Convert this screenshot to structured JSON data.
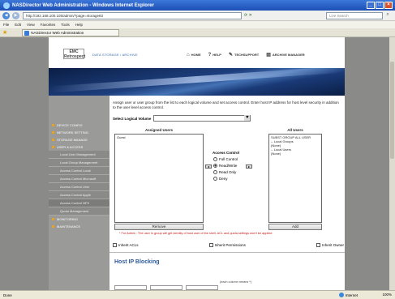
{
  "window": {
    "title": "NASDirector Web Administration - Windows Internet Explorer",
    "controls": [
      "_",
      "□",
      "×"
    ]
  },
  "address_bar": {
    "url": "http://192.168.100.105/admin/?page=storage83",
    "search_placeholder": "Live Search"
  },
  "menu": [
    "File",
    "Edit",
    "View",
    "Favorites",
    "Tools",
    "Help"
  ],
  "tab": {
    "label": "NASDirector Web Administration"
  },
  "header": {
    "logo_line1": "EMC",
    "logo_line2": "Retrospect",
    "tagline": "DATA STORAGE / ARCHIVE",
    "nav": [
      {
        "icon": "home-icon",
        "glyph": "⌂",
        "label": "HOME"
      },
      {
        "icon": "help-icon",
        "glyph": "?",
        "label": "HELP"
      },
      {
        "icon": "wrench-icon",
        "glyph": "✎",
        "label": "TECHSUPPORT"
      },
      {
        "icon": "archive-icon",
        "glyph": "▤",
        "label": "ARCHIVE MANAGER"
      }
    ]
  },
  "sidebar": {
    "items": [
      "DEVICE CONFIG",
      "NETWORK SETTING",
      "STORAGE MANAGE",
      "USER & ACCESS"
    ],
    "subitems": [
      "Local User Management",
      "Local Group Management",
      "Access Control Local",
      "Access Control Microsoft",
      "Access Control Unix",
      "Access Control Apple",
      "Access Control NFS",
      "Quota Management"
    ],
    "bottom_items": [
      "MONITORING",
      "MAINTENANCE"
    ]
  },
  "content": {
    "instructions": "Assign user or user group from the list to each logical volume and set access control. Enter host IP address for host level security in addition to the user level access control.",
    "volume_label": "Select Logical Volume",
    "assigned_title": "Assigned Users",
    "assigned_users": [
      "Guest"
    ],
    "all_users_title": "All Users",
    "all_users": [
      "SUBST GROUP ALL USER",
      "-- Local Groups",
      "(None)",
      "-- Local Users",
      "(None)"
    ],
    "access_control_title": "Access Control",
    "access_options": [
      "Full Control",
      "Read/Write",
      "Read Only",
      "Deny"
    ],
    "access_selected": "Read/Write",
    "remove_button": "Remove",
    "add_button": "Add",
    "footnote": "* For Admin : The user in group will get identity of host user of the shell, ACL and quota settings won't be applied",
    "checkboxes": [
      "Inherit ACLs",
      "Inherit Permissions",
      "Inherit Owner"
    ],
    "host_ip_title": "Host IP Blocking",
    "host_ip_note": "(each column means *)"
  },
  "status": {
    "done": "Done",
    "zone": "Internet",
    "zoom": "100%"
  }
}
